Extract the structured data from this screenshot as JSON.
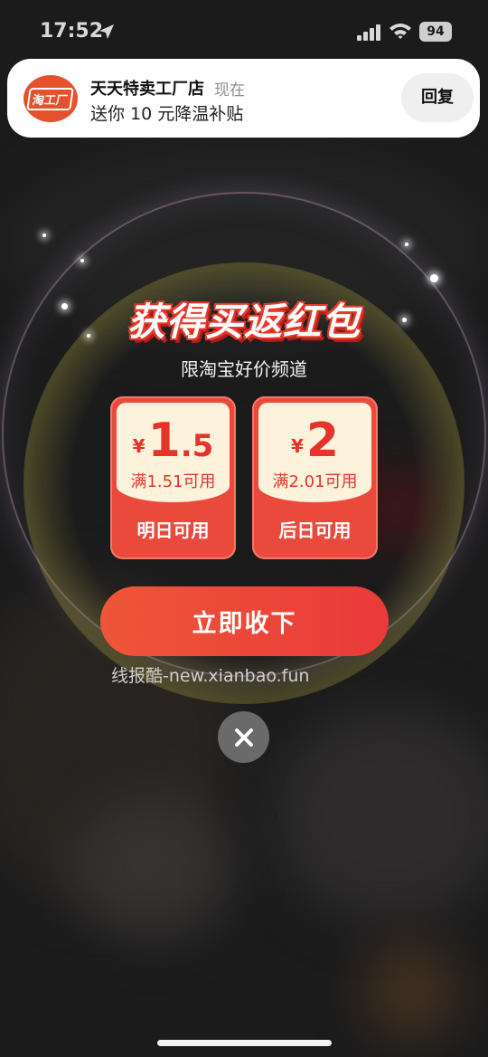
{
  "status_bar": {
    "time": "17:52",
    "battery": "94"
  },
  "notification": {
    "app_icon_text": "淘工厂",
    "title": "天天特卖工厂店",
    "time": "现在",
    "body": "送你 10 元降温补贴",
    "reply_label": "回复"
  },
  "popup": {
    "headline": "获得买返红包",
    "subtitle": "限淘宝好价频道",
    "coupons": [
      {
        "currency": "¥",
        "amount_int": "1",
        "amount_dec": ".5",
        "condition": "满1.51可用",
        "availability": "明日可用"
      },
      {
        "currency": "¥",
        "amount_int": "2",
        "amount_dec": "",
        "condition": "满2.01可用",
        "availability": "后日可用"
      }
    ],
    "cta_label": "立即收下",
    "watermark": "线报酷-new.xianbao.fun"
  },
  "colors": {
    "accent_red": "#ea4a3c",
    "coupon_face": "#fdf3dc",
    "cta_gradient_start": "#ee5638",
    "cta_gradient_end": "#ea3a3a"
  },
  "icons": {
    "location": "location-arrow-icon",
    "signal": "cellular-signal-icon",
    "wifi": "wifi-icon",
    "close": "close-icon"
  }
}
